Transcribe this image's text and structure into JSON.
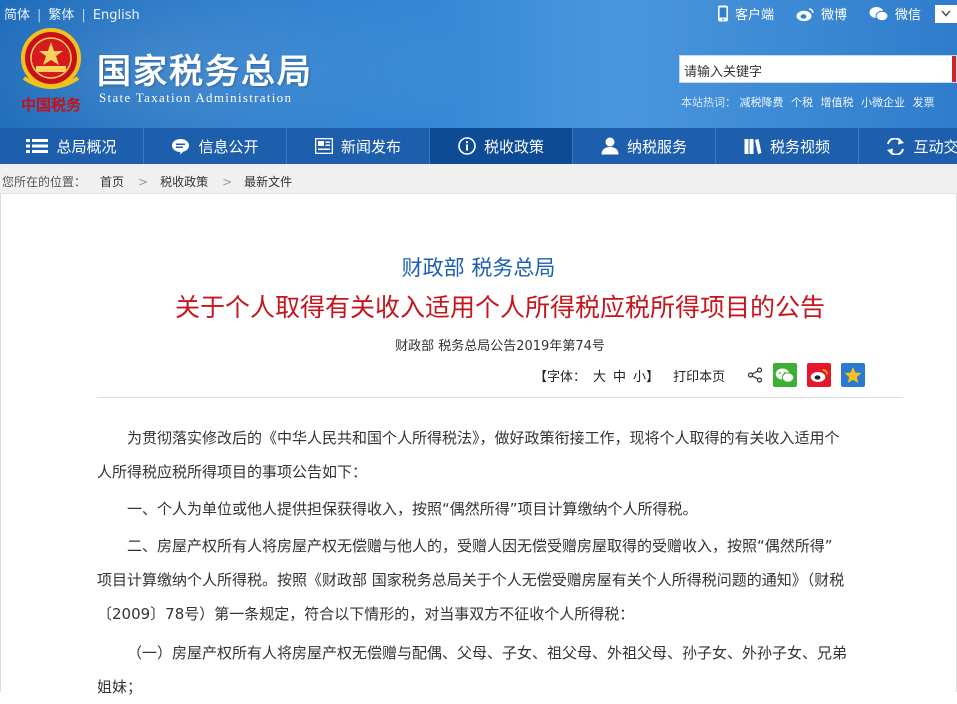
{
  "header": {
    "lang": [
      "简体",
      "繁体",
      "English"
    ],
    "emblem_text": "中国税务",
    "title_cn": "国家税务总局",
    "title_en": "State Taxation Administration",
    "top_links": {
      "client": "客户端",
      "weibo": "微博",
      "wechat": "微信"
    },
    "search_placeholder": "请输入关键字",
    "hot_label": "本站热词：",
    "hot_words": [
      "减税降费",
      "个税",
      "增值税",
      "小微企业",
      "发票"
    ]
  },
  "nav": {
    "items": [
      "总局概况",
      "信息公开",
      "新闻发布",
      "税收政策",
      "纳税服务",
      "税务视频",
      "互动交流"
    ],
    "active_index": 3
  },
  "breadcrumb": {
    "label": "您所在的位置：",
    "items": [
      "首页",
      "税收政策",
      "最新文件"
    ]
  },
  "article": {
    "issuer": "财政部 税务总局",
    "title": "关于个人取得有关收入适用个人所得税应税所得项目的公告",
    "doc_no": "财政部 税务总局公告2019年第74号",
    "tools": {
      "font_prefix": "【字体：",
      "font_sizes": [
        "大",
        "中",
        "小"
      ],
      "font_suffix": "】",
      "print": "打印本页"
    },
    "paragraphs": [
      "为贯彻落实修改后的《中华人民共和国个人所得税法》，做好政策衔接工作，现将个人取得的有关收入适用个",
      "人所得税应税所得项目的事项公告如下：",
      "一、个人为单位或他人提供担保获得收入，按照“偶然所得”项目计算缴纳个人所得税。",
      "二、房屋产权所有人将房屋产权无偿赠与他人的，受赠人因无偿受赠房屋取得的受赠收入，按照“偶然所得”",
      "项目计算缴纳个人所得税。按照《财政部 国家税务总局关于个人无偿受赠房屋有关个人所得税问题的通知》（财税",
      "〔2009〕78号）第一条规定，符合以下情形的，对当事双方不征收个人所得税：",
      "（一）房屋产权所有人将房屋产权无偿赠与配偶、父母、子女、祖父母、外祖父母、孙子女、外孙子女、兄弟",
      "姐妹；"
    ]
  },
  "colors": {
    "nav": "#1d5fac",
    "nav_active": "#0d4b95",
    "title_red": "#c4161c",
    "issuer_blue": "#1f5fb0"
  }
}
